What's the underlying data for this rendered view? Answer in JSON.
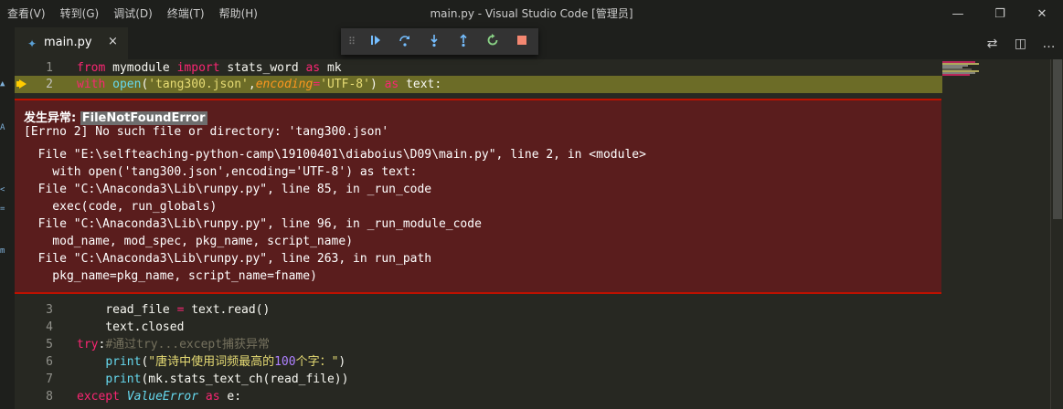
{
  "menu": [
    "查看(V)",
    "转到(G)",
    "调试(D)",
    "终端(T)",
    "帮助(H)"
  ],
  "window_title": "main.py - Visual Studio Code [管理员]",
  "window_controls": {
    "minimize": "—",
    "restore": "❐",
    "close": "✕"
  },
  "tab": {
    "label": "main.py",
    "icon": "python-file-icon",
    "close": "×"
  },
  "editor_actions": [
    {
      "name": "open-changes-icon",
      "glyph": "⇄"
    },
    {
      "name": "split-editor-icon",
      "glyph": "◫"
    },
    {
      "name": "more-actions-icon",
      "glyph": "…"
    }
  ],
  "debug_toolbar": {
    "drag_handle": "⠿",
    "buttons": [
      "continue-icon",
      "step-over-icon",
      "step-into-icon",
      "step-out-icon",
      "restart-icon",
      "stop-icon"
    ],
    "colors": {
      "blue": "#75beff",
      "green": "#89d185",
      "red": "#f48771"
    }
  },
  "code_lines": [
    {
      "number": "1",
      "highlight": false,
      "tokens": [
        [
          "kw",
          "from"
        ],
        [
          "t",
          " mymodule "
        ],
        [
          "kw",
          "import"
        ],
        [
          "t",
          " stats_word "
        ],
        [
          "kw",
          "as"
        ],
        [
          "t",
          " mk"
        ]
      ]
    },
    {
      "number": "2",
      "highlight": true,
      "breakpoint": true,
      "tokens": [
        [
          "kw",
          "with"
        ],
        [
          "t",
          " "
        ],
        [
          "fn",
          "open"
        ],
        [
          "t",
          "("
        ],
        [
          "str",
          "'tang300.json'"
        ],
        [
          "t",
          ","
        ],
        [
          "param",
          "encoding"
        ],
        [
          "kw",
          "="
        ],
        [
          "str",
          "'UTF-8'"
        ],
        [
          "t",
          ") "
        ],
        [
          "kw",
          "as"
        ],
        [
          "t",
          " text:"
        ]
      ]
    },
    {
      "number": "3",
      "highlight": false,
      "tokens": [
        [
          "t",
          "    read_file "
        ],
        [
          "kw",
          "="
        ],
        [
          "t",
          " text.read()"
        ]
      ]
    },
    {
      "number": "4",
      "highlight": false,
      "tokens": [
        [
          "t",
          "    text.closed"
        ]
      ]
    },
    {
      "number": "5",
      "highlight": false,
      "tokens": [
        [
          "kw",
          "try"
        ],
        [
          "t",
          ":"
        ],
        [
          "cmt",
          "#通过try...except捕获异常"
        ]
      ]
    },
    {
      "number": "6",
      "highlight": false,
      "tokens": [
        [
          "t",
          "    "
        ],
        [
          "fn",
          "print"
        ],
        [
          "t",
          "("
        ],
        [
          "str",
          "\"唐诗中使用词频最高的"
        ],
        [
          "num",
          "100"
        ],
        [
          "str",
          "个字：\""
        ],
        [
          "t",
          ")"
        ]
      ]
    },
    {
      "number": "7",
      "highlight": false,
      "tokens": [
        [
          "t",
          "    "
        ],
        [
          "fn",
          "print"
        ],
        [
          "t",
          "(mk.stats_text_ch(read_file))"
        ]
      ]
    },
    {
      "number": "8",
      "highlight": false,
      "tokens": [
        [
          "kw",
          "except"
        ],
        [
          "t",
          " "
        ],
        [
          "cls",
          "ValueError"
        ],
        [
          "t",
          " "
        ],
        [
          "kw",
          "as"
        ],
        [
          "t",
          " e:"
        ]
      ]
    }
  ],
  "exception": {
    "label": "发生异常: ",
    "type": "FileNotFoundError",
    "message": "[Errno 2] No such file or directory: 'tang300.json'",
    "trace": [
      "  File \"E:\\selfteaching-python-camp\\19100401\\diaboius\\D09\\main.py\", line 2, in <module>",
      "    with open('tang300.json',encoding='UTF-8') as text:",
      "  File \"C:\\Anaconda3\\Lib\\runpy.py\", line 85, in _run_code",
      "    exec(code, run_globals)",
      "  File \"C:\\Anaconda3\\Lib\\runpy.py\", line 96, in _run_module_code",
      "    mod_name, mod_spec, pkg_name, script_name)",
      "  File \"C:\\Anaconda3\\Lib\\runpy.py\", line 263, in run_path",
      "    pkg_name=pkg_name, script_name=fname)"
    ]
  },
  "sidebar_glyphs": [
    "▲",
    "A",
    "<",
    "=",
    "m"
  ]
}
